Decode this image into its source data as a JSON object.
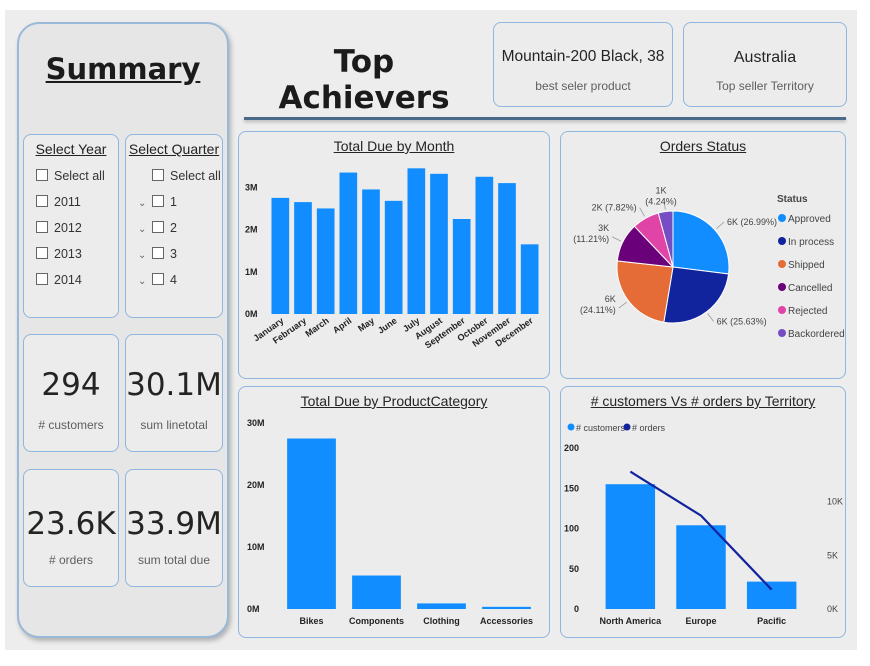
{
  "summary": {
    "title": "Summary"
  },
  "year_slicer": {
    "title": "Select Year",
    "items": [
      "Select all",
      "2011",
      "2012",
      "2013",
      "2014"
    ]
  },
  "quarter_slicer": {
    "title": "Select Quarter",
    "items": [
      "Select all",
      "1",
      "2",
      "3",
      "4"
    ]
  },
  "kpis": [
    {
      "value": "294",
      "label": "# customers"
    },
    {
      "value": "30.1M",
      "label": "sum linetotal"
    },
    {
      "value": "23.6K",
      "label": "# orders"
    },
    {
      "value": "33.9M",
      "label": "sum total due"
    }
  ],
  "header": {
    "title": "Top Achievers",
    "product_value": "Mountain-200 Black, 38",
    "product_label": "best seler product",
    "territory_value": "Australia",
    "territory_label": "Top seller Territory"
  },
  "colors": {
    "bar": "#118dff",
    "line": "#12239e",
    "accent_border": "#8fb6de"
  },
  "chart_data": [
    {
      "type": "bar",
      "title": "Total Due by Month",
      "categories": [
        "January",
        "February",
        "March",
        "April",
        "May",
        "June",
        "July",
        "August",
        "September",
        "October",
        "November",
        "December"
      ],
      "values": [
        2.75,
        2.65,
        2.5,
        3.35,
        2.95,
        2.68,
        3.45,
        3.32,
        2.25,
        3.25,
        3.1,
        1.65
      ],
      "y_ticks": [
        "0M",
        "1M",
        "2M",
        "3M"
      ],
      "ylim": [
        0,
        3.6
      ],
      "unit": "M"
    },
    {
      "type": "pie",
      "title": "Orders Status",
      "legend_title": "Status",
      "slices": [
        {
          "name": "Approved",
          "value": 26.99,
          "label": "6K (26.99%)",
          "color": "#118dff"
        },
        {
          "name": "In process",
          "value": 25.63,
          "label": "6K (25.63%)",
          "color": "#12239e"
        },
        {
          "name": "Shipped",
          "value": 24.11,
          "label_lines": [
            "6K",
            "(24.11%)"
          ],
          "color": "#e66c37"
        },
        {
          "name": "Cancelled",
          "value": 11.21,
          "label_lines": [
            "3K",
            "(11.21%)"
          ],
          "color": "#6b007b"
        },
        {
          "name": "Rejected",
          "value": 7.82,
          "label": "2K (7.82%)",
          "color": "#e044a7"
        },
        {
          "name": "Backordered",
          "value": 4.24,
          "label_lines": [
            "1K",
            "(4.24%)"
          ],
          "color": "#744ec2"
        }
      ]
    },
    {
      "type": "bar",
      "title": "Total Due by ProductCategory",
      "categories": [
        "Bikes",
        "Components",
        "Clothing",
        "Accessories"
      ],
      "values": [
        27.5,
        5.4,
        0.9,
        0.35
      ],
      "y_ticks": [
        "0M",
        "10M",
        "20M",
        "30M"
      ],
      "ylim": [
        0,
        30
      ],
      "unit": "M"
    },
    {
      "type": "bar",
      "title": "# customers Vs # orders by Territory",
      "categories": [
        "North America",
        "Europe",
        "Pacific"
      ],
      "series": [
        {
          "name": "# customers",
          "type": "bar",
          "axis": "left",
          "values": [
            155,
            104,
            34
          ]
        },
        {
          "name": "# orders",
          "type": "line",
          "axis": "right",
          "values": [
            12800,
            8700,
            1800
          ]
        }
      ],
      "y_left_ticks": [
        "0",
        "50",
        "100",
        "150",
        "200"
      ],
      "y_left_lim": [
        0,
        200
      ],
      "y_right_ticks": [
        "0K",
        "5K",
        "10K"
      ],
      "y_right_lim": [
        0,
        15000
      ]
    }
  ]
}
